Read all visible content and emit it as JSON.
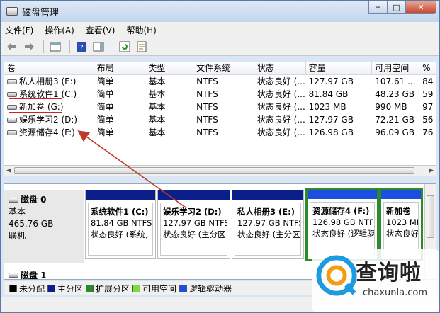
{
  "window": {
    "title": "磁盘管理",
    "minimize": "─",
    "maximize": "□",
    "close": "✕"
  },
  "menu": [
    "文件(F)",
    "操作(A)",
    "查看(V)",
    "帮助(H)"
  ],
  "table": {
    "columns": [
      "卷",
      "布局",
      "类型",
      "文件系统",
      "状态",
      "容量",
      "可用空间",
      "%"
    ],
    "rows": [
      [
        "私人相册3 (E:)",
        "简单",
        "基本",
        "NTFS",
        "状态良好 (...",
        "127.97 GB",
        "107.61 ...",
        "84"
      ],
      [
        "系统软件1 (C:)",
        "简单",
        "基本",
        "NTFS",
        "状态良好 (...",
        "81.84 GB",
        "48.23 GB",
        "59"
      ],
      [
        "新加卷 (G:)",
        "简单",
        "基本",
        "NTFS",
        "状态良好 (...",
        "1023 MB",
        "990 MB",
        "97"
      ],
      [
        "娱乐学习2 (D:)",
        "简单",
        "基本",
        "NTFS",
        "状态良好 (...",
        "127.97 GB",
        "72.21 GB",
        "56"
      ],
      [
        "资源储存4 (F:)",
        "简单",
        "基本",
        "NTFS",
        "状态良好 (...",
        "126.98 GB",
        "96.09 GB",
        "76"
      ]
    ]
  },
  "disk0": {
    "name": "磁盘 0",
    "type": "基本",
    "size": "465.76 GB",
    "state": "联机"
  },
  "partitions": [
    {
      "name": "系统软件1 (C:)",
      "size": "81.84 GB NTFS",
      "status": "状态良好 (系统,"
    },
    {
      "name": "娱乐学习2 (D:)",
      "size": "127.97 GB NTFS",
      "status": "状态良好 (主分区"
    },
    {
      "name": "私人相册3 (E:)",
      "size": "127.97 GB NTFS",
      "status": "状态良好 (主分区"
    },
    {
      "name": "资源储存4 (F:)",
      "size": "126.98 GB NTFS",
      "status": "状态良好 (逻辑驱"
    },
    {
      "name": "新加卷",
      "size": "1023 MB",
      "status": "状态良好"
    }
  ],
  "disk1": {
    "name": "磁盘 1"
  },
  "legend": [
    {
      "label": "未分配",
      "color": "#000000"
    },
    {
      "label": "主分区",
      "color": "#0a1f8a"
    },
    {
      "label": "扩展分区",
      "color": "#2b8a2b"
    },
    {
      "label": "可用空间",
      "color": "#7ddc3a"
    },
    {
      "label": "逻辑驱动器",
      "color": "#1c4fe0"
    }
  ],
  "watermark": {
    "text": "查询啦",
    "url": "chaxunla.com"
  }
}
